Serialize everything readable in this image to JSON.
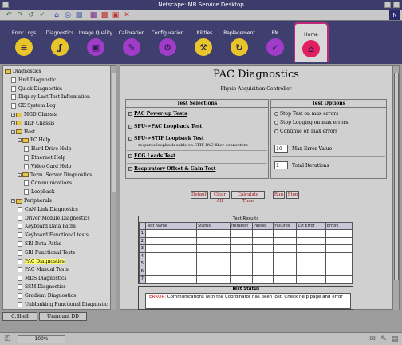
{
  "window": {
    "title": "Netscape: MR Service Desktop"
  },
  "nav": {
    "tabs": [
      {
        "label": "Error Logs",
        "icon": "log-icon",
        "glyph": "≡",
        "color": "#e8c52a"
      },
      {
        "label": "Diagnostics",
        "icon": "stethoscope-icon",
        "glyph": "ʆ",
        "color": "#e8c52a"
      },
      {
        "label": "Image Quality",
        "icon": "image-icon",
        "glyph": "▣",
        "color": "#a03cc8"
      },
      {
        "label": "Calibration",
        "icon": "calibration-icon",
        "glyph": "✎",
        "color": "#a03cc8"
      },
      {
        "label": "Configuration",
        "icon": "configuration-icon",
        "glyph": "⚙",
        "color": "#a03cc8"
      },
      {
        "label": "Utilities",
        "icon": "tools-icon",
        "glyph": "⚒",
        "color": "#e8c52a"
      },
      {
        "label": "Replacement",
        "icon": "replacement-icon",
        "glyph": "↻",
        "color": "#e8c52a"
      },
      {
        "label": "PM",
        "icon": "pm-icon",
        "glyph": "✓",
        "color": "#a03cc8"
      },
      {
        "label": "Home",
        "icon": "home-icon",
        "glyph": "⌂",
        "color": "#e02060"
      }
    ]
  },
  "tree": {
    "items": [
      {
        "label": "Diagnostics",
        "kind": "folder",
        "level": 0,
        "exp": ""
      },
      {
        "label": "Hnd Diagnostic",
        "kind": "page",
        "level": 1,
        "exp": ""
      },
      {
        "label": "Quick Diagnostics",
        "kind": "page",
        "level": 1,
        "exp": ""
      },
      {
        "label": "Display Last Test Information",
        "kind": "page",
        "level": 1,
        "exp": ""
      },
      {
        "label": "GE System Log",
        "kind": "page",
        "level": 1,
        "exp": ""
      },
      {
        "label": "MGD Chassis",
        "kind": "folder",
        "level": 1,
        "exp": "+"
      },
      {
        "label": "RRF Chassis",
        "kind": "folder",
        "level": 1,
        "exp": "+"
      },
      {
        "label": "Host",
        "kind": "folder",
        "level": 1,
        "exp": "-"
      },
      {
        "label": "PC Help",
        "kind": "folder",
        "level": 2,
        "exp": "-"
      },
      {
        "label": "Hard Drive Help",
        "kind": "page",
        "level": 3,
        "exp": ""
      },
      {
        "label": "Ethernet Help",
        "kind": "page",
        "level": 3,
        "exp": ""
      },
      {
        "label": "Video Card Help",
        "kind": "page",
        "level": 3,
        "exp": ""
      },
      {
        "label": "Term. Server Diagnostics",
        "kind": "folder",
        "level": 2,
        "exp": "-"
      },
      {
        "label": "Communications",
        "kind": "page",
        "level": 3,
        "exp": ""
      },
      {
        "label": "Loopback",
        "kind": "page",
        "level": 3,
        "exp": ""
      },
      {
        "label": "Peripherals",
        "kind": "folder",
        "level": 1,
        "exp": "-"
      },
      {
        "label": "CAN Link Diagnostics",
        "kind": "page",
        "level": 2,
        "exp": ""
      },
      {
        "label": "Driver Module Diagnostics",
        "kind": "page",
        "level": 2,
        "exp": ""
      },
      {
        "label": "Keyboard Data Paths",
        "kind": "page",
        "level": 2,
        "exp": ""
      },
      {
        "label": "Keyboard Functional tests",
        "kind": "page",
        "level": 2,
        "exp": ""
      },
      {
        "label": "SRI Data Paths",
        "kind": "page",
        "level": 2,
        "exp": ""
      },
      {
        "label": "SRI Functional Tests",
        "kind": "page",
        "level": 2,
        "exp": ""
      },
      {
        "label": "PAC Diagnostics",
        "kind": "page",
        "level": 2,
        "exp": "",
        "selected": true
      },
      {
        "label": "PAC Manual Tests",
        "kind": "page",
        "level": 2,
        "exp": ""
      },
      {
        "label": "MDS Diagnostics",
        "kind": "page",
        "level": 2,
        "exp": ""
      },
      {
        "label": "SSM Diagnostics",
        "kind": "page",
        "level": 2,
        "exp": ""
      },
      {
        "label": "Gradient Diagnostics",
        "kind": "page",
        "level": 2,
        "exp": ""
      },
      {
        "label": "Unblanking Functional Diagnostic",
        "kind": "page",
        "level": 2,
        "exp": ""
      }
    ]
  },
  "main": {
    "title": "PAC Diagnostics",
    "subtitle": "Physio Acquisition Controller",
    "test_selections": {
      "header": "Test Selections",
      "tests": [
        {
          "label": "PAC Power-up Tests",
          "note": ""
        },
        {
          "label": "SPU->PAC Loopback Test",
          "note": ""
        },
        {
          "label": "SPU->STIF Loopback Test",
          "note": "- requires loopback cable on STIF PAC fiber connectors"
        },
        {
          "label": "ECG Leads Test",
          "note": ""
        },
        {
          "label": "Respiratory Offset & Gain Test",
          "note": ""
        }
      ]
    },
    "test_options": {
      "header": "Test Options",
      "radios": [
        "Stop Test on max errors",
        "Stop Logging on max errors",
        "Continue on max errors"
      ],
      "max_error_value": "10",
      "max_error_label": "Max Error Value",
      "iterations_value": "1",
      "iterations_label": "Total Iterations"
    },
    "buttons": {
      "default": "Default",
      "clear_all": "Clear All",
      "calc_time": "Calculate Time",
      "run": "Run",
      "stop": "Stop"
    },
    "results": {
      "header": "Test Results",
      "columns": [
        "Test Name",
        "Status",
        "Iteration",
        "Passes",
        "Failures",
        "1st Error",
        "Errors"
      ],
      "rows": [
        "1",
        "2",
        "3",
        "4",
        "5",
        "6",
        "7"
      ]
    },
    "status": {
      "header": "Test Status",
      "error_label": "ERROR:",
      "message": "Communications with the Coordinator has been lost.  Check help page and error"
    }
  },
  "bottom_tabs": [
    "C.Shell",
    "Unmount DD"
  ],
  "statusbar": {
    "zoom": "100%"
  }
}
